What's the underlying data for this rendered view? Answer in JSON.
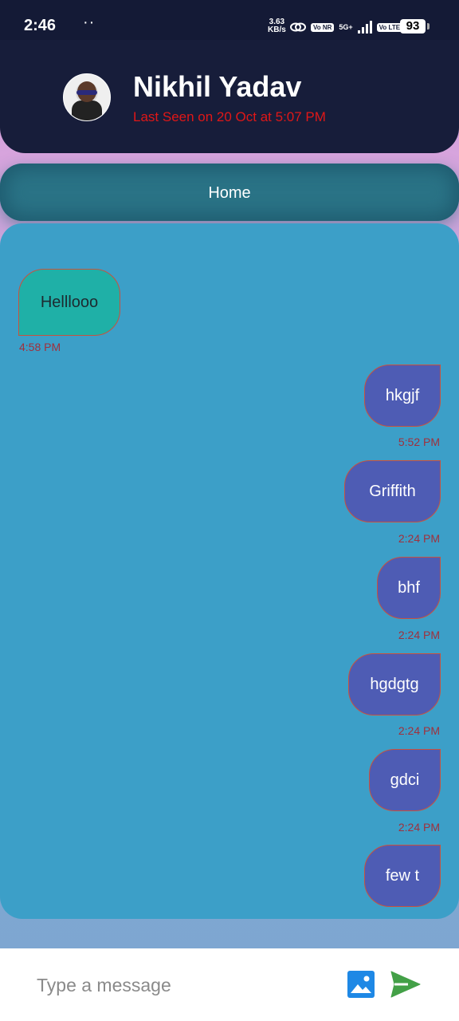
{
  "status_bar": {
    "time": "2:46",
    "dots": "··",
    "speed_value": "3.63",
    "speed_unit": "KB/s",
    "network_label": "5G+",
    "volte_1": "Vo NR",
    "volte_2": "Vo LTE",
    "battery": "93"
  },
  "header": {
    "name": "Nikhil Yadav",
    "last_seen": "Last Seen on 20 Oct at 5:07 PM"
  },
  "nav": {
    "home_label": "Home"
  },
  "messages": [
    {
      "direction": "in",
      "text": "Helllooo",
      "time": "4:58 PM"
    },
    {
      "direction": "out",
      "text": "hkgjf",
      "time": "5:52 PM"
    },
    {
      "direction": "out",
      "text": "Griffith",
      "time": "2:24 PM"
    },
    {
      "direction": "out",
      "text": "bhf",
      "time": "2:24 PM"
    },
    {
      "direction": "out",
      "text": "hgdgtg",
      "time": "2:24 PM"
    },
    {
      "direction": "out",
      "text": "gdci",
      "time": "2:24 PM"
    },
    {
      "direction": "out",
      "text": "few t",
      "time": ""
    }
  ],
  "composer": {
    "placeholder": "Type a message",
    "value": "",
    "image_icon": "image-icon",
    "send_icon": "send-icon"
  },
  "colors": {
    "header_bg": "#171d3a",
    "chat_bg": "#3c9fc8",
    "incoming_bubble": "#1fb0a7",
    "outgoing_bubble": "#4e5cb4",
    "last_seen": "#e01717",
    "timestamp": "#a0303c",
    "send_icon": "#43a047",
    "image_icon": "#1e88e5"
  }
}
